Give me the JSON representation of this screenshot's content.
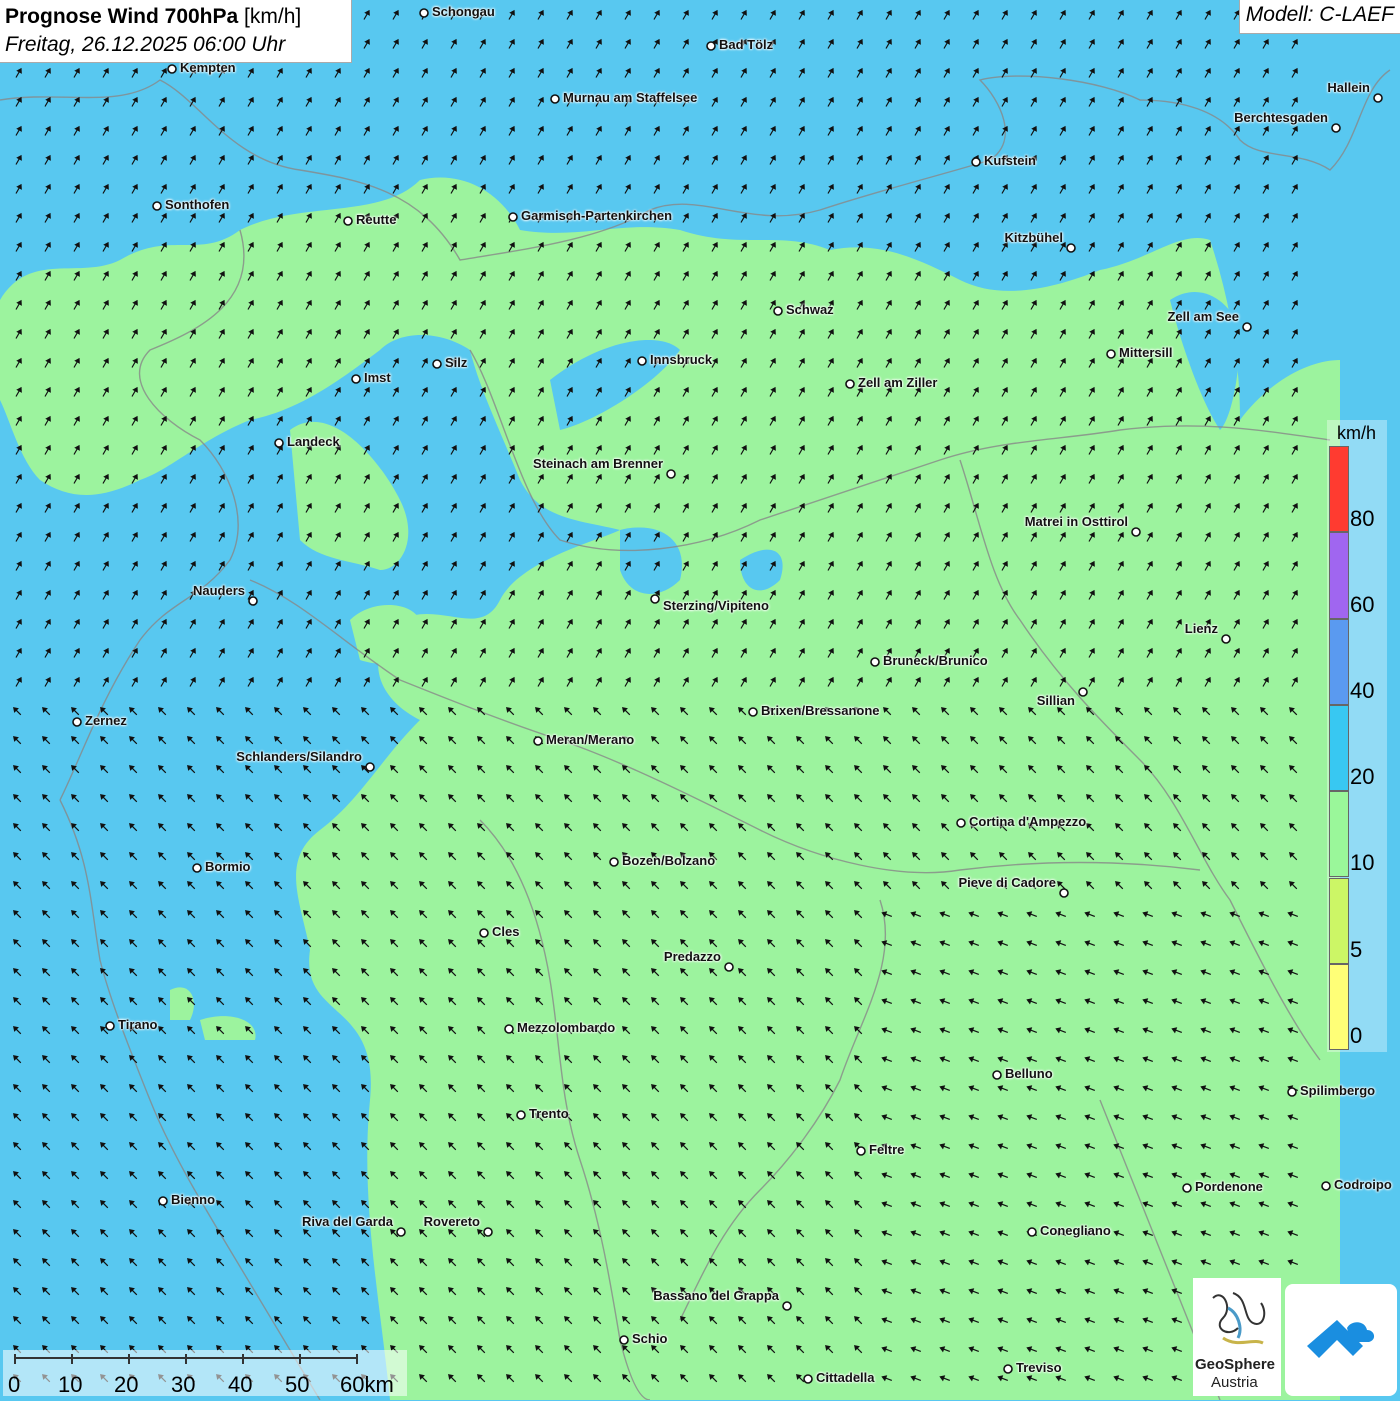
{
  "title": {
    "main": "Prognose Wind 700hPa",
    "unit": "[km/h]",
    "datetime": "Freitag, 26.12.2025 06:00 Uhr"
  },
  "model": "Modell: C-LAEF",
  "legend": {
    "unit": "km/h",
    "ticks": [
      "80",
      "60",
      "40",
      "20",
      "10",
      "5",
      "0"
    ],
    "colors": [
      "#ff3b30",
      "#a066f0",
      "#5a9af0",
      "#38c8f2",
      "#9af79a",
      "#ccf666",
      "#ffff77"
    ]
  },
  "scale_bar": {
    "labels": [
      "0",
      "10",
      "20",
      "30",
      "40",
      "50",
      "60km"
    ]
  },
  "logos": {
    "geosphere_line1": "GeoSphere",
    "geosphere_line2": "Austria",
    "app_icon": "cloud-mountain-icon"
  },
  "cities": [
    {
      "name": "Schongau"
    },
    {
      "name": "Bad Tölz"
    },
    {
      "name": "Kempten"
    },
    {
      "name": "Murnau am Staffelsee"
    },
    {
      "name": "Hallein"
    },
    {
      "name": "Berchtesgaden"
    },
    {
      "name": "Kufstein"
    },
    {
      "name": "Sonthofen"
    },
    {
      "name": "Reutte"
    },
    {
      "name": "Garmisch-Partenkirchen"
    },
    {
      "name": "Kitzbühel"
    },
    {
      "name": "Schwaz"
    },
    {
      "name": "Zell am See"
    },
    {
      "name": "Innsbruck"
    },
    {
      "name": "Mittersill"
    },
    {
      "name": "Imst"
    },
    {
      "name": "Silz"
    },
    {
      "name": "Zell am Ziller"
    },
    {
      "name": "Landeck"
    },
    {
      "name": "Steinach am Brenner"
    },
    {
      "name": "Matrei in Osttirol"
    },
    {
      "name": "Nauders"
    },
    {
      "name": "Sterzing/Vipiteno"
    },
    {
      "name": "Lienz"
    },
    {
      "name": "Bruneck/Brunico"
    },
    {
      "name": "Sillian"
    },
    {
      "name": "Zernez"
    },
    {
      "name": "Brixen/Bressanone"
    },
    {
      "name": "Meran/Merano"
    },
    {
      "name": "Schlanders/Silandro"
    },
    {
      "name": "Cortina d'Ampezzo"
    },
    {
      "name": "Bozen/Bolzano"
    },
    {
      "name": "Bormio"
    },
    {
      "name": "Pieve di Cadore"
    },
    {
      "name": "Cles"
    },
    {
      "name": "Predazzo"
    },
    {
      "name": "Tirano"
    },
    {
      "name": "Mezzolombardo"
    },
    {
      "name": "Belluno"
    },
    {
      "name": "Spilimbergo"
    },
    {
      "name": "Trento"
    },
    {
      "name": "Feltre"
    },
    {
      "name": "Pordenone"
    },
    {
      "name": "Codroipo"
    },
    {
      "name": "Bienno"
    },
    {
      "name": "Riva del Garda"
    },
    {
      "name": "Rovereto"
    },
    {
      "name": "Conegliano"
    },
    {
      "name": "Bassano del Grappa"
    },
    {
      "name": "Schio"
    },
    {
      "name": "Treviso"
    },
    {
      "name": "Cittadella"
    }
  ]
}
